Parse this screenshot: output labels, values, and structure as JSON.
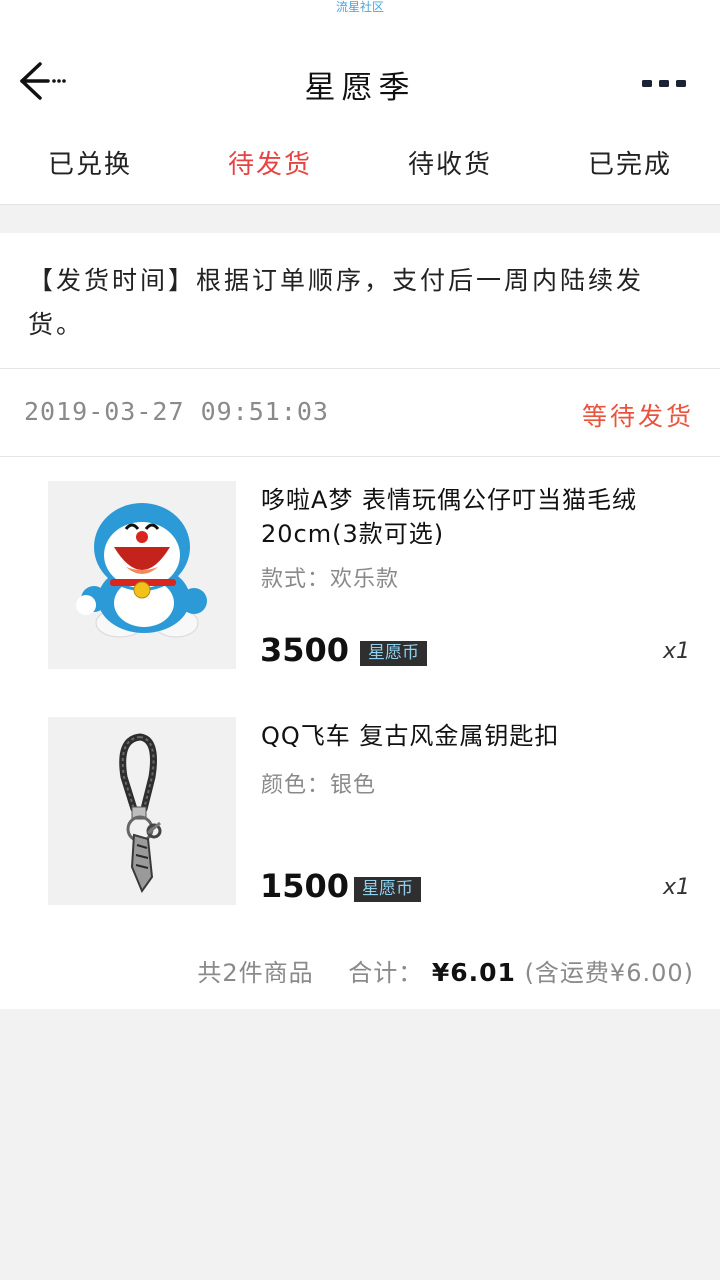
{
  "status_bar": {
    "label": "流星社区"
  },
  "header": {
    "title": "星愿季",
    "back_icon": "arrow-left-icon",
    "more_icon": "more-dots-icon"
  },
  "tabs": [
    {
      "label": "已兑换",
      "active": false
    },
    {
      "label": "待发货",
      "active": true
    },
    {
      "label": "待收货",
      "active": false
    },
    {
      "label": "已完成",
      "active": false
    }
  ],
  "notice": "【发货时间】根据订单顺序，支付后一周内陆续发货。",
  "order": {
    "time": "2019-03-27 09:51:03",
    "status": "等待发货",
    "items": [
      {
        "name": "哆啦A梦 表情玩偶公仔叮当猫毛绒20cm(3款可选)",
        "attr": "款式：欢乐款",
        "price": "3500",
        "currency": "星愿币",
        "qty": "x1",
        "image": "doraemon-plush-image"
      },
      {
        "name": "QQ飞车 复古风金属钥匙扣",
        "attr": "颜色：银色",
        "price": "1500",
        "currency": "星愿币",
        "qty": "x1",
        "image": "keychain-image"
      }
    ],
    "summary": {
      "count_text": "共2件商品",
      "total_label": "合计：",
      "total": "¥6.01",
      "shipping": "(含运费¥6.00)"
    }
  },
  "colors": {
    "accent": "#e84343",
    "status_orange": "#e8543d",
    "coin_text": "#8ed0f0"
  }
}
